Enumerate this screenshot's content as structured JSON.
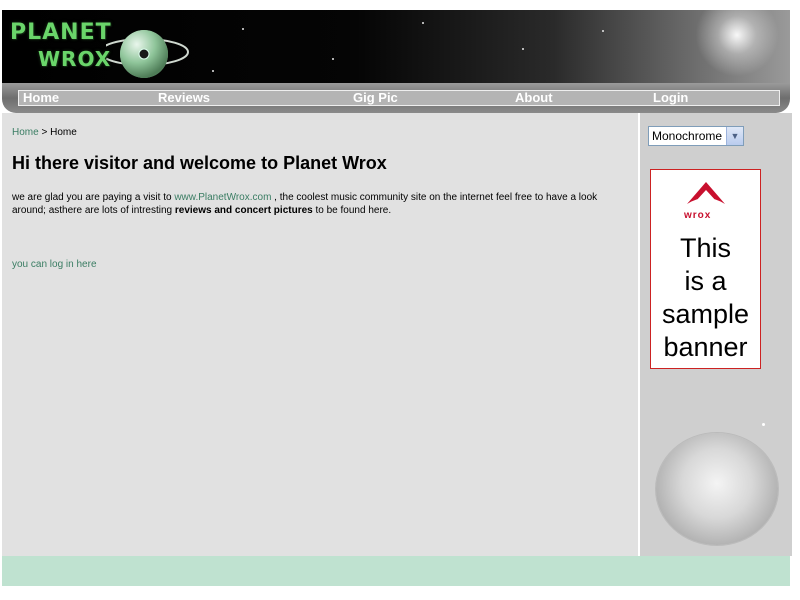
{
  "header": {
    "logo_line1": "PLANET",
    "logo_line2": "WROX"
  },
  "menu": {
    "items": [
      {
        "label": "Home"
      },
      {
        "label": "Reviews"
      },
      {
        "label": "Gig Pic"
      },
      {
        "label": "About"
      },
      {
        "label": "Login"
      }
    ]
  },
  "main": {
    "breadcrumb": {
      "home_link": "Home",
      "separator": ">",
      "current": "Home"
    },
    "title": "Hi there visitor and welcome to Planet Wrox",
    "intro": {
      "text_before": "we are glad you are paying a visit to ",
      "link_text": "www.PlanetWrox.com",
      "text_middle": " , the coolest music community site on the internet feel free to have a look around; asthere are lots of intresting ",
      "bold_text": "reviews and concert pictures",
      "text_after": " to be found here."
    },
    "login_link": "you can log in here"
  },
  "sidebar": {
    "theme_select": {
      "value": "Monochrome",
      "options": [
        "Monochrome"
      ]
    },
    "banner": {
      "brand": "wrox",
      "text_line1": "This",
      "text_line2": "is a",
      "text_line3": "sample",
      "text_line4": "banner"
    }
  },
  "colors": {
    "link": "#3a7d63",
    "footer": "#bfe2d0",
    "main_bg": "#e1e1e1",
    "banner_border": "#cc2222",
    "logo_green": "#6ad56a"
  },
  "icons": {
    "logo": "planet-cd-logo-icon",
    "dropdown": "chevron-down-icon",
    "banner_logo": "wrox-logo-icon"
  }
}
